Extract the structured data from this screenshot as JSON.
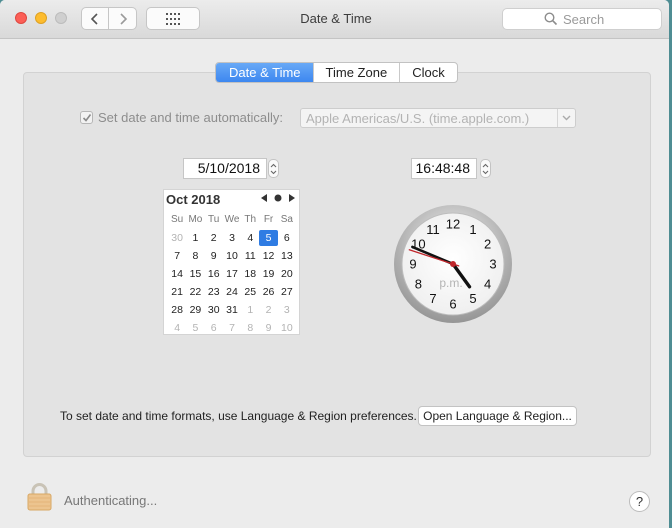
{
  "window": {
    "title": "Date & Time"
  },
  "toolbar": {
    "search_placeholder": "Search"
  },
  "tabs": [
    {
      "label": "Date & Time",
      "active": true
    },
    {
      "label": "Time Zone",
      "active": false
    },
    {
      "label": "Clock",
      "active": false
    }
  ],
  "auto": {
    "label": "Set date and time automatically:",
    "checked": true,
    "server": "Apple Americas/U.S. (time.apple.com.)"
  },
  "date_value": "5/10/2018",
  "time_value": "16:48:48",
  "calendar": {
    "title": "Oct 2018",
    "weekdays": [
      "Su",
      "Mo",
      "Tu",
      "We",
      "Th",
      "Fr",
      "Sa"
    ],
    "weeks": [
      [
        "30",
        "1",
        "2",
        "3",
        "4",
        "5",
        "6"
      ],
      [
        "7",
        "8",
        "9",
        "10",
        "11",
        "12",
        "13"
      ],
      [
        "14",
        "15",
        "16",
        "17",
        "18",
        "19",
        "20"
      ],
      [
        "21",
        "22",
        "23",
        "24",
        "25",
        "26",
        "27"
      ],
      [
        "28",
        "29",
        "30",
        "31",
        "1",
        "2",
        "3"
      ],
      [
        "4",
        "5",
        "6",
        "7",
        "8",
        "9",
        "10"
      ]
    ],
    "selected": "5"
  },
  "clock": {
    "numbers": [
      "12",
      "1",
      "2",
      "3",
      "4",
      "5",
      "6",
      "7",
      "8",
      "9",
      "10",
      "11"
    ],
    "ampm": "p.m.",
    "hour": 16,
    "minute": 48,
    "second": 48
  },
  "formats": {
    "text": "To set date and time formats, use Language & Region preferences.",
    "button": "Open Language & Region..."
  },
  "status": {
    "text": "Authenticating..."
  },
  "help": {
    "label": "?"
  },
  "colors": {
    "accent": "#3d87f0",
    "selected_day": "#2f7ce3",
    "second_hand": "#c0262b"
  }
}
